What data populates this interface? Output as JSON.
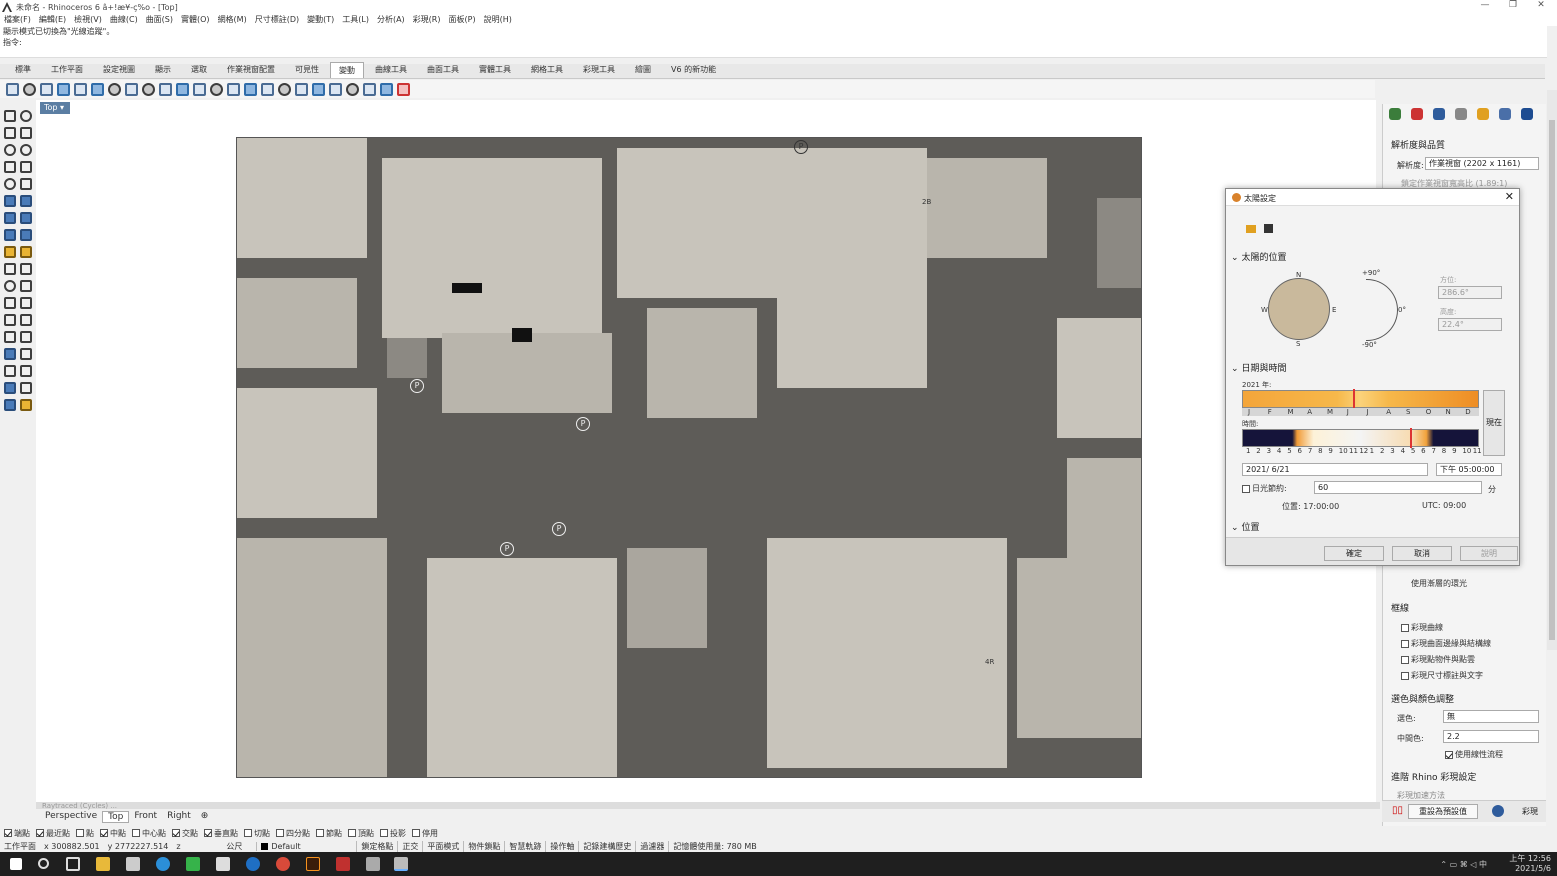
{
  "window": {
    "title": "未命名 - Rhinoceros 6 â+!æ¥-ç%o - [Top]",
    "controls": [
      "—",
      "❐",
      "✕"
    ]
  },
  "menu": [
    "檔案(F)",
    "編輯(E)",
    "檢視(V)",
    "曲線(C)",
    "曲面(S)",
    "實體(O)",
    "網格(M)",
    "尺寸標註(D)",
    "變動(T)",
    "工具(L)",
    "分析(A)",
    "彩現(R)",
    "面板(P)",
    "說明(H)"
  ],
  "command_history": [
    "",
    "顯示模式已切換為\"光線追蹤\"。",
    "指令:"
  ],
  "toolbar_tabs": [
    "標準",
    "工作平面",
    "設定視圖",
    "顯示",
    "選取",
    "作業視窗配置",
    "可見性",
    "變動",
    "曲線工具",
    "曲面工具",
    "實體工具",
    "網格工具",
    "彩現工具",
    "繪圖",
    "V6 的新功能"
  ],
  "active_tab": "變動",
  "viewport": {
    "label": "Top",
    "parking_symbol": "P",
    "map_annotations": [
      "2B",
      "4R"
    ],
    "status_text": "Raytraced (Cycles) ..."
  },
  "viewport_tabs": [
    "Perspective",
    "Top",
    "Front",
    "Right"
  ],
  "viewport_tab_add": "⊕",
  "active_viewport_tab": "Top",
  "osnaps": [
    {
      "label": "端點",
      "on": true
    },
    {
      "label": "最近點",
      "on": true
    },
    {
      "label": "點",
      "on": false
    },
    {
      "label": "中點",
      "on": true
    },
    {
      "label": "中心點",
      "on": false
    },
    {
      "label": "交點",
      "on": true
    },
    {
      "label": "垂直點",
      "on": true
    },
    {
      "label": "切點",
      "on": false
    },
    {
      "label": "四分點",
      "on": false
    },
    {
      "label": "節點",
      "on": false
    },
    {
      "label": "頂點",
      "on": false
    },
    {
      "label": "投影",
      "on": false
    },
    {
      "label": "停用",
      "on": false
    }
  ],
  "status": {
    "plane": "工作平面",
    "x": "x 300882.501",
    "y": "y 2772227.514",
    "z": "z",
    "unit": "公尺",
    "layer": "Default",
    "toggles": [
      "鎖定格點",
      "正交",
      "平面模式",
      "物件鎖點",
      "智慧軌跡",
      "操作軸",
      "記錄建構歷史",
      "過濾器"
    ],
    "memory": "記憶體使用量: 780 MB"
  },
  "taskbar": {
    "time": "上午 12:56",
    "date": "2021/5/6",
    "tray": "⌃ ▭ ⌘ ◁ 中"
  },
  "right_panel": {
    "section1": "解析度與品質",
    "resolution_label": "解析度:",
    "resolution_value": "作業視窗 (2202 x 1161)",
    "lock_ratio": "鎖定作業視窗寬高比 (1.89:1)",
    "background_check": "使用漸層的環光",
    "section_frame": "框線",
    "frame_opts": [
      "彩現曲線",
      "彩現曲面邊緣與結構線",
      "彩現點物件與點雲",
      "彩現尺寸標註與文字"
    ],
    "section_exposure": "選色與顏色調整",
    "exposure_label": "選色:",
    "exposure_value": "無",
    "gamma_label": "中間色:",
    "gamma_value": "2.2",
    "linear": "使用線性流程",
    "section_adv": "進階 Rhino 彩現設定",
    "adv_sub": "彩現加速方法",
    "reset_btn": "重設為預設值",
    "render_btn": "彩現"
  },
  "sun_dialog": {
    "title": "太陽設定",
    "close": "✕",
    "section_position": "太陽的位置",
    "compass": {
      "n": "N",
      "s": "S",
      "e": "E",
      "w": "W"
    },
    "alt_labels": {
      "top": "+90°",
      "zero": "0°",
      "bottom": "-90°"
    },
    "azimuth_label": "方位:",
    "azimuth": "286.6°",
    "altitude_label": "高度:",
    "altitude": "22.4°",
    "section_datetime": "日期與時間",
    "year_label": "2021 年:",
    "months": [
      "J",
      "F",
      "M",
      "A",
      "M",
      "J",
      "J",
      "A",
      "S",
      "O",
      "N",
      "D"
    ],
    "month_marker": 0.47,
    "hour_label": "時間:",
    "hours": [
      "1",
      "2",
      "3",
      "4",
      "5",
      "6",
      "7",
      "8",
      "9",
      "10",
      "11",
      "12",
      "1",
      "2",
      "3",
      "4",
      "5",
      "6",
      "7",
      "8",
      "9",
      "10",
      "11"
    ],
    "hour_marker": 0.71,
    "now_btn": "現在",
    "date": "2021/ 6/21",
    "time": "下午 05:00:00",
    "dst_label": "日光節約:",
    "dst_value": "60",
    "dst_unit": "分",
    "local": "位置: 17:00:00",
    "utc": "UTC: 09:00",
    "section_location": "位置",
    "ok": "確定",
    "cancel": "取消",
    "help": "說明",
    "colors": {
      "accent": "#d9822b",
      "night": "#15143a",
      "marker": "#d33"
    }
  }
}
